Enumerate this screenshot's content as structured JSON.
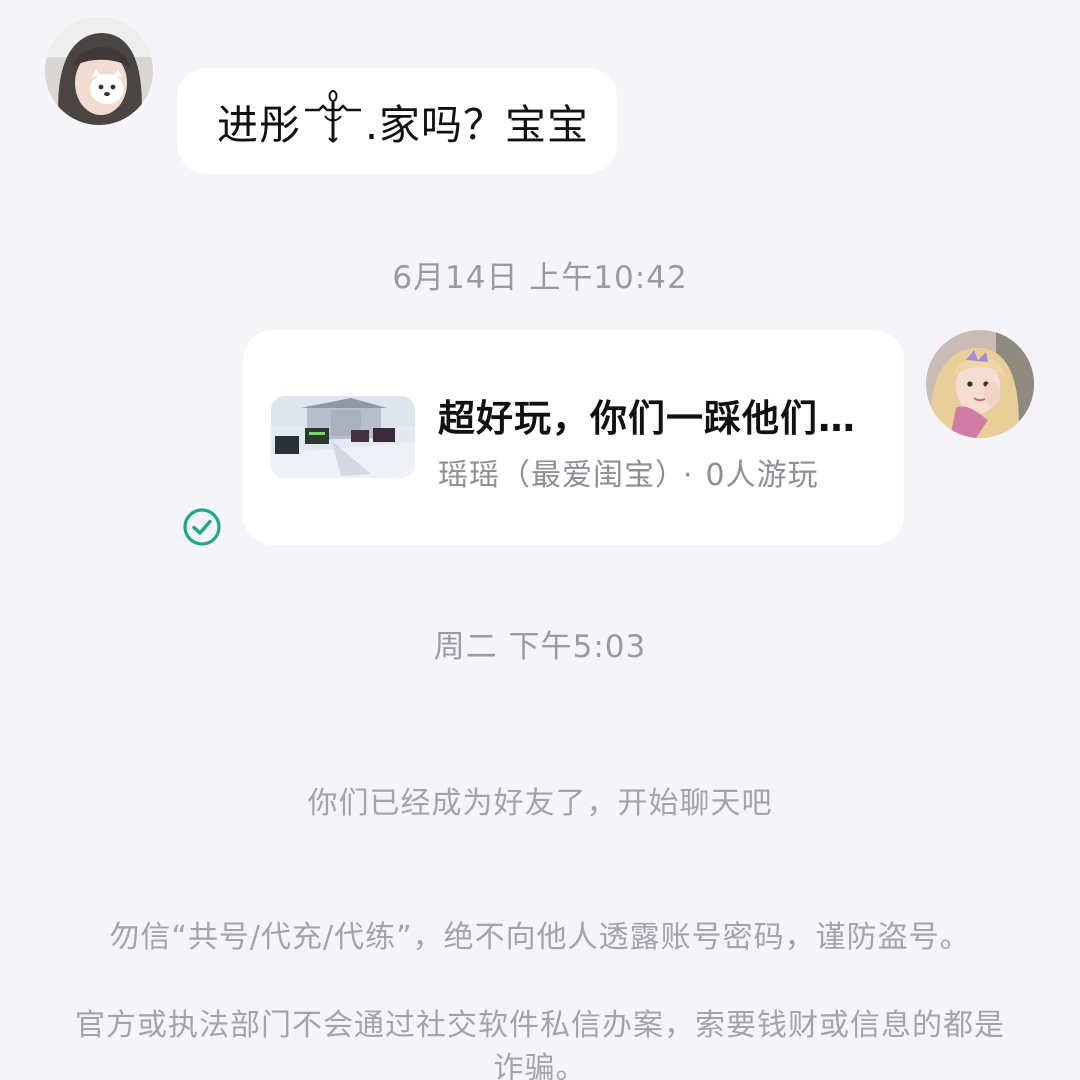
{
  "messages": {
    "incoming_prefix": "进彤",
    "incoming_suffix": ".家吗？宝宝",
    "timestamp_1": "6月14日 上午10:42",
    "timestamp_2": "周二 下午5:03"
  },
  "share_card": {
    "title": "超好玩，你们一踩他们…",
    "author": "瑶瑶（最爱闺宝）",
    "separator": "·",
    "players": "0人游玩"
  },
  "icons": {
    "status": "check-circle-icon",
    "emblem": "emblem-icon"
  },
  "notices": {
    "friend": "你们已经成为好友了，开始聊天吧",
    "warning_1": "勿信“共号/代充/代练”，绝不向他人透露账号密码，谨防盗号。",
    "warning_2": "官方或执法部门不会通过社交软件私信办案，索要钱财或信息的都是诈骗。"
  },
  "colors": {
    "background": "#f4f4f9",
    "bubble": "#ffffff",
    "check": "#1aaa85"
  }
}
